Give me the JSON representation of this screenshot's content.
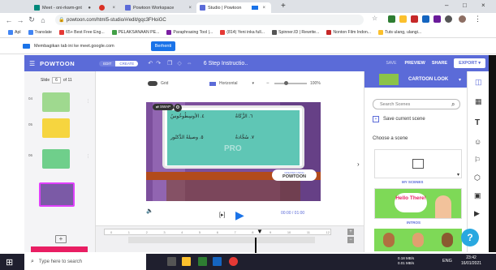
{
  "tabs": [
    {
      "label": "Meet - oni-rkwm-gnt",
      "color": "#00897b"
    },
    {
      "label": "",
      "color": "#d93025"
    },
    {
      "label": "Powtoon Workspace",
      "color": "#5b6bd8"
    },
    {
      "label": "Studio | Powtoon",
      "color": "#5b6bd8"
    }
  ],
  "address": {
    "url": "powtoon.com/html5-studio/#/edit/gqc3FHoiGC"
  },
  "bookmarks": [
    {
      "label": "Apl",
      "color": "#4285f4"
    },
    {
      "label": "Translate",
      "color": "#4285f4"
    },
    {
      "label": "65+ Best Free Eng...",
      "color": "#e53935"
    },
    {
      "label": "PELAKSANAAN PE...",
      "color": "#43a047"
    },
    {
      "label": "Paraphrasing Tool |...",
      "color": "#7b1fa2"
    },
    {
      "label": "(814) Yeni inka full...",
      "color": "#e53935"
    },
    {
      "label": "Spinner.ID | Rewrite...",
      "color": "#555555"
    },
    {
      "label": "Nonton Film Indon...",
      "color": "#c62828"
    },
    {
      "label": "Tuts ulang, ulangi...",
      "color": "#fbc02d"
    }
  ],
  "sharebar": {
    "text": "Membagikan tab ini ke meet.google.com",
    "button": "Berhenti"
  },
  "header": {
    "logo": "POWTOON",
    "toggle_edit": "EDIT",
    "toggle_create": "CREATE",
    "step": "6 Step Instructio..",
    "save": "SAVE",
    "preview": "PREVIEW",
    "share": "SHARE",
    "export": "EXPORT"
  },
  "slides": {
    "label": "Slide",
    "current": "6",
    "total": "of 11",
    "numbers": [
      "04",
      "05",
      "06"
    ]
  },
  "canvas": {
    "grid": "Grid",
    "horizontal": "Horizontal",
    "zoom": "100%",
    "swap": "SWAP",
    "arabic": [
      "٤. الأوسِطُوخُوسُ",
      "٥. وصيلةُ الدَّكتُور",
      "٦. الزَّكَاةُ",
      "٧. سُجَّادةُ"
    ],
    "watermark": "PRO",
    "badge": "POWTOON",
    "badge_sub": "CREATED USING",
    "time": "00:00 / 01:00"
  },
  "timeline": {
    "ticks": [
      "0",
      "1",
      "2",
      "3",
      "4",
      "5",
      "6",
      "7",
      "8",
      "9",
      "10",
      "11",
      "12"
    ]
  },
  "rightpanel": {
    "title": "CARTOON LOOK",
    "search_placeholder": "Search Scenes",
    "save_scene": "Save current scene",
    "choose": "Choose a scene",
    "my_scenes": "MY SCENES",
    "hello": "Hello There!",
    "intros": "INTROS"
  },
  "taskbar": {
    "search": "Type here to search",
    "net": "0.18 MB/s",
    "net2": "0.01 MB/s",
    "lang": "ENG",
    "time": "23:42",
    "date": "16/01/2021"
  }
}
